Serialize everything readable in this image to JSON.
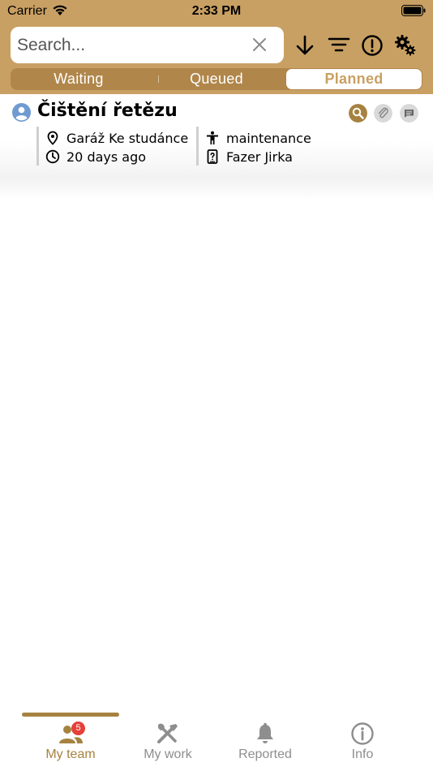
{
  "status_bar": {
    "carrier": "Carrier",
    "time": "2:33 PM"
  },
  "search": {
    "placeholder": "Search..."
  },
  "segments": [
    {
      "label": "Waiting",
      "active": false
    },
    {
      "label": "Queued",
      "active": false
    },
    {
      "label": "Planned",
      "active": true
    }
  ],
  "tasks": [
    {
      "title": "Čištění řetězu",
      "location": "Garáž Ke studánce",
      "time_ago": "20 days ago",
      "category": "maintenance",
      "assignee": "Fazer Jirka"
    }
  ],
  "tabbar": {
    "tabs": [
      {
        "label": "My team",
        "active": true,
        "badge": "5"
      },
      {
        "label": "My work",
        "active": false
      },
      {
        "label": "Reported",
        "active": false
      },
      {
        "label": "Info",
        "active": false
      }
    ]
  },
  "colors": {
    "header_bg": "#c9a063",
    "segment_bg": "#b0864a",
    "accent": "#a68240",
    "badge": "#e5403a",
    "avatar": "#6f9bd1"
  },
  "icons": {
    "toolbar": [
      "sort-down-icon",
      "filter-icon",
      "alert-icon",
      "settings-icon"
    ],
    "task_actions": [
      "search-zoom-icon",
      "attachment-icon",
      "comment-icon"
    ],
    "task_details": [
      "location-pin-icon",
      "clock-icon",
      "person-icon",
      "device-icon"
    ]
  }
}
